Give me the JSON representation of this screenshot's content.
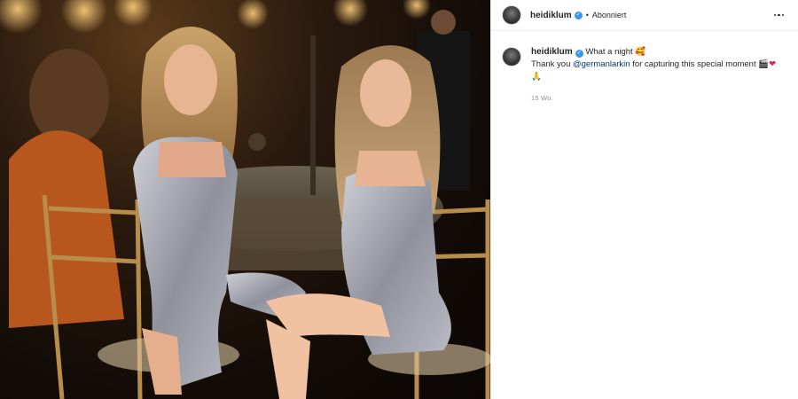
{
  "post": {
    "username": "heidiklum",
    "verified_icon": "verified-badge-icon",
    "separator": "•",
    "follow_status": "Abonniert",
    "more_icon": "more-options-icon"
  },
  "caption": {
    "username": "heidiklum",
    "line1": "What a night 🥰",
    "line2_prefix": "Thank you ",
    "mention": "@germanlarkin",
    "line2_suffix": " for capturing this special moment 🎬",
    "heart": "❤",
    "line3": "🙏",
    "timestamp": "15 Wo."
  },
  "colors": {
    "verified": "#3897f0",
    "mention": "#00376b",
    "muted": "#8e8e8e"
  }
}
